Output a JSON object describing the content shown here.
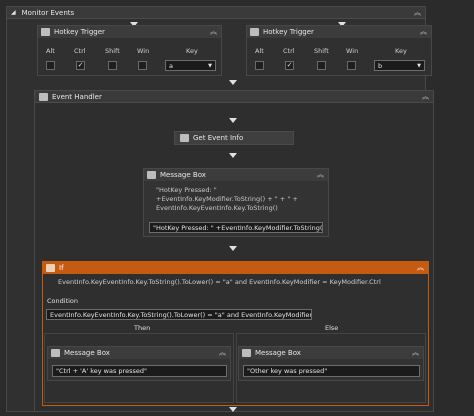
{
  "monitor": {
    "title": "Monitor Events"
  },
  "hotkey_left": {
    "title": "Hotkey Trigger",
    "cols": {
      "alt": "Alt",
      "ctrl": "Ctrl",
      "shift": "Shift",
      "win": "Win",
      "key": "Key"
    },
    "alt_checked": false,
    "ctrl_checked": true,
    "shift_checked": false,
    "win_checked": false,
    "key_value": "a"
  },
  "hotkey_right": {
    "title": "Hotkey Trigger",
    "cols": {
      "alt": "Alt",
      "ctrl": "Ctrl",
      "shift": "Shift",
      "win": "Win",
      "key": "Key"
    },
    "alt_checked": false,
    "ctrl_checked": true,
    "shift_checked": false,
    "win_checked": false,
    "key_value": "b"
  },
  "handler": {
    "title": "Event Handler"
  },
  "get_event_info": {
    "label": "Get Event Info"
  },
  "message_box_main": {
    "title": "Message Box",
    "preview_lines": [
      "\"HotKey Pressed: \"",
      "+EventInfo.KeyModifier.ToString() + \" + \" +",
      "EventInfo.KeyEventInfo.Key.ToString()"
    ],
    "input_value": "\"HotKey Pressed: \" +EventInfo.KeyModifier.ToString() +"
  },
  "if_block": {
    "title": "If",
    "summary": "EventInfo.KeyEventInfo.Key.ToString().ToLower() = \"a\" and EventInfo.KeyModifier = KeyModifier.Ctrl",
    "condition_label": "Condition",
    "condition_value": "EventInfo.KeyEventInfo.Key.ToString().ToLower() = \"a\" and EventInfo.KeyModifier =",
    "then_label": "Then",
    "else_label": "Else",
    "accent_color": "#c55a11"
  },
  "message_box_then": {
    "title": "Message Box",
    "value": "\"Ctrl + 'A' key was pressed\""
  },
  "message_box_else": {
    "title": "Message Box",
    "value": "\"Other key was pressed\""
  }
}
